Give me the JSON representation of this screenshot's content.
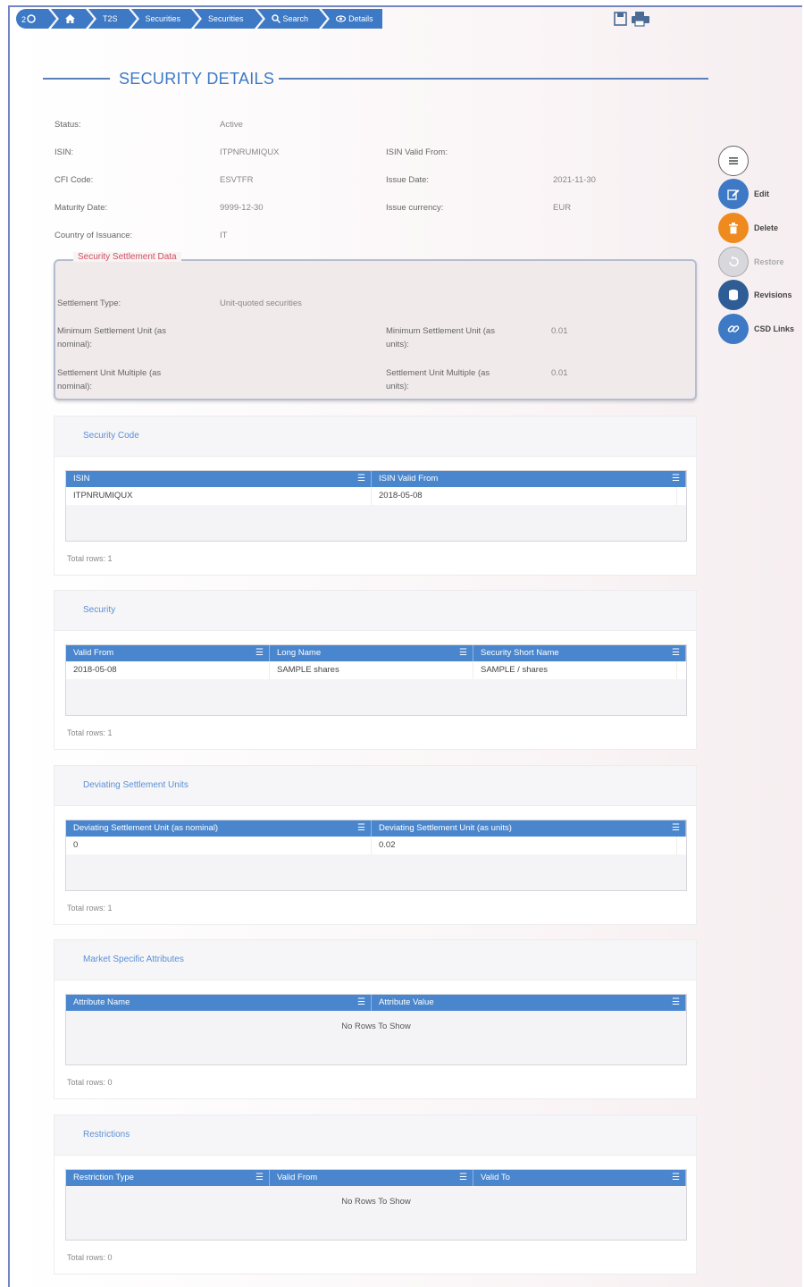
{
  "breadcrumb": [
    "T2S",
    "Securities",
    "Securities",
    "Search",
    "Details"
  ],
  "heading": "SECURITY DETAILS",
  "fields": {
    "status": {
      "label": "Status:",
      "value": "Active"
    },
    "isin": {
      "label": "ISIN:",
      "value": "ITPNRUMIQUX"
    },
    "isin_valid_from": {
      "label": "ISIN Valid From:",
      "value": ""
    },
    "cfi_code": {
      "label": "CFI Code:",
      "value": "ESVTFR"
    },
    "issue_date": {
      "label": "Issue Date:",
      "value": "2021-11-30"
    },
    "maturity_date": {
      "label": "Maturity Date:",
      "value": "9999-12-30"
    },
    "issue_currency": {
      "label": "Issue currency:",
      "value": "EUR"
    },
    "country_of_issuance": {
      "label": "Country of Issuance:",
      "value": "IT"
    }
  },
  "settlement": {
    "legend": "Security Settlement Data",
    "settlement_type": {
      "label": "Settlement Type:",
      "value": "Unit-quoted securities"
    },
    "min_unit_nominal": {
      "label1": "Minimum Settlement Unit (as",
      "label2": "nominal):",
      "value": ""
    },
    "min_unit_units": {
      "label1": "Minimum Settlement Unit (as",
      "label2": "units):",
      "value": "0.01"
    },
    "multiple_nominal": {
      "label1": "Settlement Unit Multiple (as",
      "label2": "nominal):",
      "value": ""
    },
    "multiple_units": {
      "label1": "Settlement Unit Multiple (as",
      "label2": "units):",
      "value": "0.01"
    }
  },
  "actions": {
    "edit": "Edit",
    "delete": "Delete",
    "restore": "Restore",
    "revisions": "Revisions",
    "csd_links": "CSD Links"
  },
  "panels": {
    "security_code": {
      "title": "Security Code",
      "columns": [
        "ISIN",
        "ISIN Valid From"
      ],
      "row": [
        "ITPNRUMIQUX",
        "2018-05-08"
      ],
      "total": "Total rows: 1"
    },
    "security": {
      "title": "Security",
      "columns": [
        "Valid From",
        "Long Name",
        "Security Short Name"
      ],
      "row": [
        "2018-05-08",
        "SAMPLE shares",
        "SAMPLE / shares"
      ],
      "total": "Total rows: 1"
    },
    "deviating": {
      "title": "Deviating Settlement Units",
      "columns": [
        "Deviating Settlement Unit (as nominal)",
        "Deviating Settlement Unit (as units)"
      ],
      "row": [
        "0",
        "0.02"
      ],
      "total": "Total rows: 1"
    },
    "market": {
      "title": "Market Specific Attributes",
      "columns": [
        "Attribute Name",
        "Attribute Value"
      ],
      "empty": "No Rows To Show",
      "total": "Total rows: 0"
    },
    "restrictions": {
      "title": "Restrictions",
      "columns": [
        "Restriction Type",
        "Valid From",
        "Valid To"
      ],
      "empty": "No Rows To Show",
      "total": "Total rows: 0"
    }
  },
  "colors": {
    "accent": "#3d79c4",
    "delete": "#ee8a1e",
    "legend": "#d0505e"
  }
}
